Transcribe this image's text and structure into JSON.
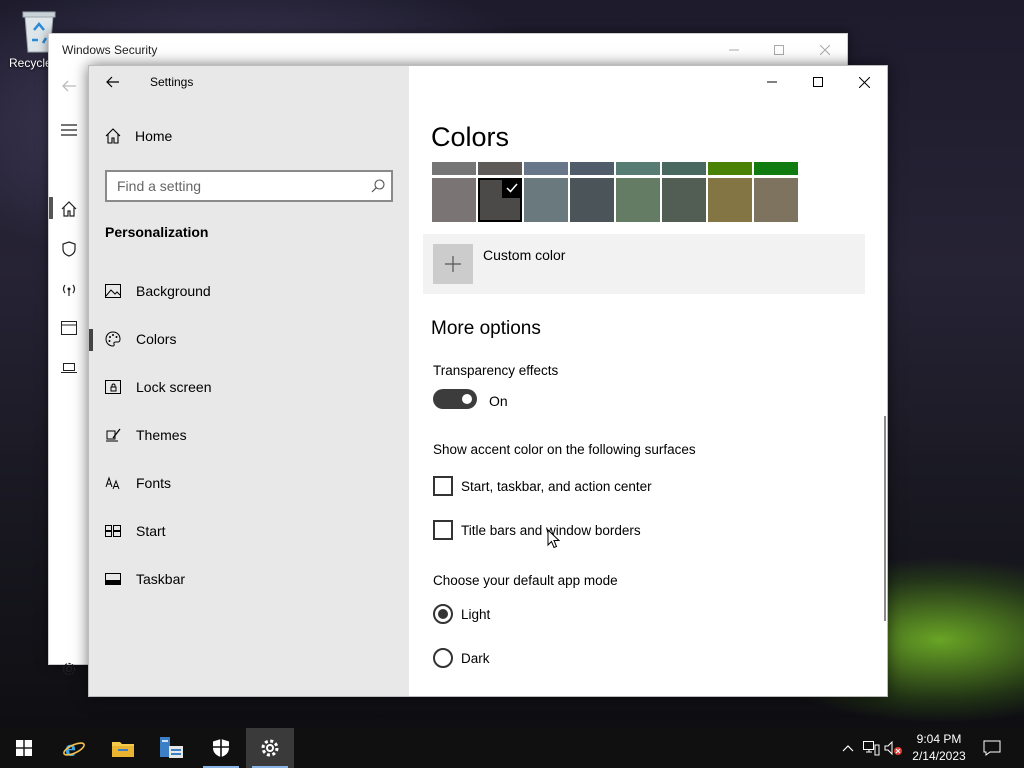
{
  "desktop": {
    "recycle_bin_label": "Recycle"
  },
  "security_window": {
    "title": "Windows Security"
  },
  "settings": {
    "app_title": "Settings",
    "nav": {
      "home_label": "Home",
      "search_placeholder": "Find a setting",
      "section_title": "Personalization",
      "items": [
        {
          "label": "Background",
          "icon": "picture-icon"
        },
        {
          "label": "Colors",
          "icon": "palette-icon",
          "active": true
        },
        {
          "label": "Lock screen",
          "icon": "lock-screen-icon"
        },
        {
          "label": "Themes",
          "icon": "themes-icon"
        },
        {
          "label": "Fonts",
          "icon": "fonts-icon"
        },
        {
          "label": "Start",
          "icon": "start-icon"
        },
        {
          "label": "Taskbar",
          "icon": "taskbar-icon"
        }
      ]
    },
    "content": {
      "page_title": "Colors",
      "swatches_top": [
        "#767676",
        "#5d5a58",
        "#68768a",
        "#515c6b",
        "#567c73",
        "#486860",
        "#498205",
        "#107c10"
      ],
      "swatches_main": [
        "#7a7574",
        "#4c4a48",
        "#69797e",
        "#4a5459",
        "#647c64",
        "#525e54",
        "#847545",
        "#7e735f"
      ],
      "selected_swatch": "#4c4a48",
      "custom_color_label": "Custom color",
      "more_options_title": "More options",
      "transparency_label": "Transparency effects",
      "transparency_state": "On",
      "transparency_on": true,
      "accent_surfaces_label": "Show accent color on the following surfaces",
      "accent_checkboxes": [
        {
          "label": "Start, taskbar, and action center",
          "checked": false
        },
        {
          "label": "Title bars and window borders",
          "checked": false
        }
      ],
      "app_mode_label": "Choose your default app mode",
      "app_mode_options": [
        {
          "label": "Light",
          "selected": true
        },
        {
          "label": "Dark",
          "selected": false
        }
      ]
    }
  },
  "taskbar": {
    "apps": [
      "start-icon",
      "internet-explorer-icon",
      "file-explorer-icon",
      "server-manager-icon",
      "windows-security-icon",
      "settings-icon"
    ],
    "time": "9:04 PM",
    "date": "2/14/2023"
  }
}
